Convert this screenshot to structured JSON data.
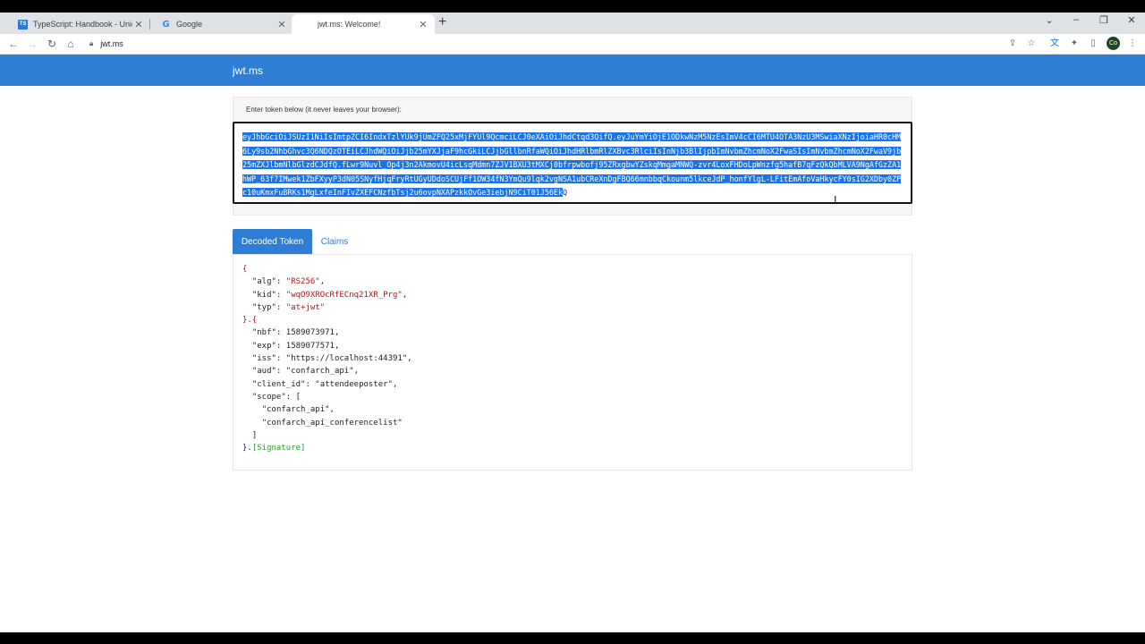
{
  "browser": {
    "tabs": [
      {
        "title": "TypeScript: Handbook - Unions a",
        "favicon": "typescript-icon"
      },
      {
        "title": "Google",
        "favicon": "google-icon"
      },
      {
        "title": "jwt.ms: Welcome!",
        "favicon": "blank-icon",
        "active": true
      }
    ],
    "new_tab_symbol": "+",
    "url": "jwt.ms",
    "profile_initials": "Co"
  },
  "site": {
    "brand": "jwt.ms",
    "accent_color": "#2d7ed4",
    "token_label": "Enter token below (it never leaves your browser):",
    "token_selected": "eyJhbGciOiJSUzI1NiIsImtpZCI6IndxTzlYUk9jUmZFQ25xMjFYUl9QcmciLCJ0eXAiOiJhdCtqd3QifQ.eyJuYmYiOjE1ODkwNzM5NzEsImV4cCI6MTU4OTA3NzU3MSwiaXNzIjoiaHR0cHM6Ly9sb2NhbGhvc3Q6NDQzOTEiLCJhdWQiOiJjb25mYXJjaF9hcGkiLCJjbGllbnRfaWQiOiJhdHRlbmRlZXBvc3RlciIsInNjb3BlIjpbImNvbmZhcmNoX2FwaSIsImNvbmZhcmNoX2FwaV9jb25mZXJlbmNlbGlzdCJdfQ.fLwr9Nuvl_Op4j3n2AkmovU4icLsqMdmn7ZJV1BXU3tMXCj0bfrpwbofj95ZRxgbwYZskqMmgaMNWQ-zvr4LoxFHDoLpWnzfg5hafB7qFzQkQbMLVA9NgAfGzZA1hWP_63f7IMwek1ZbFXyyP3dN05SNyfHjqFryRtUGyUDdoSCUjFf1OW34fN3YmQu9lqk2vgNSA1ubCReXnDgFBQ66mnbbqCkounm5lkceJdP_honfYlgL-LFitEmAfoVaHkycFY0sIG2XDby0ZPc10uKmxFuBRKs1MgLxfeInFIvZXEFCNzfbTsj2u6ovpNXAPzkkOvGe3iebjN9CiT01J56Ek",
    "token_unselected": "Q",
    "decoded_tab": "Decoded Token",
    "claims_tab": "Claims",
    "decoded": {
      "open_brace": "{",
      "header": [
        {
          "key": "\"alg\"",
          "value": "\"RS256\"",
          "trail": ","
        },
        {
          "key": "\"kid\"",
          "value": "\"wqO9XROcRfECnq21XR_Prg\"",
          "trail": ","
        },
        {
          "key": "\"typ\"",
          "value": "\"at+jwt\"",
          "trail": ""
        }
      ],
      "mid_brace": "}.{",
      "payload": [
        {
          "key": "\"nbf\"",
          "value": "1589073971",
          "trail": ","
        },
        {
          "key": "\"exp\"",
          "value": "1589077571",
          "trail": ","
        },
        {
          "key": "\"iss\"",
          "value": "\"https://localhost:44391\"",
          "trail": ","
        },
        {
          "key": "\"aud\"",
          "value": "\"confarch_api\"",
          "trail": ","
        },
        {
          "key": "\"client_id\"",
          "value": "\"attendeeposter\"",
          "trail": ","
        }
      ],
      "scope_key": "\"scope\"",
      "scope_open": "[",
      "scope_items": [
        "\"confarch_api\",",
        "\"confarch_api_conferencelist\""
      ],
      "scope_close": "]",
      "close_brace": "}.",
      "signature": "[Signature]"
    }
  }
}
